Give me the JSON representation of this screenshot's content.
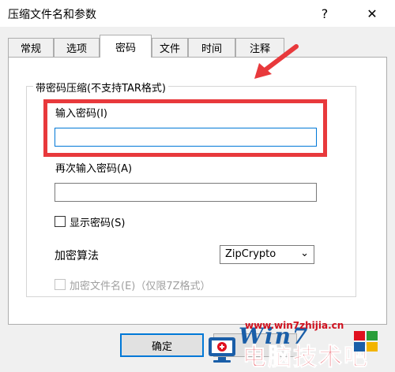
{
  "window": {
    "title": "压缩文件名和参数",
    "help": "?",
    "close": "✕"
  },
  "tabs": [
    {
      "label": "常规"
    },
    {
      "label": "选项"
    },
    {
      "label": "密码"
    },
    {
      "label": "文件"
    },
    {
      "label": "时间"
    },
    {
      "label": "注释"
    }
  ],
  "group": {
    "title": "带密码压缩(不支持TAR格式)",
    "password_label": "输入密码(I)",
    "password_value": "",
    "reenter_label": "再次输入密码(A)",
    "reenter_value": "",
    "show_password_label": "显示密码(S)",
    "algorithm_label": "加密算法",
    "algorithm_value": "ZipCrypto",
    "encrypt_names_label": "加密文件名(E)（仅限7Z格式）"
  },
  "buttons": {
    "ok": "确定"
  },
  "watermark": {
    "url": "www.win7zhijia.cn",
    "brand": "电脑技术吧",
    "logo": "Win7"
  },
  "colors": {
    "annotation": "#e8393c",
    "focus": "#0078d7"
  }
}
